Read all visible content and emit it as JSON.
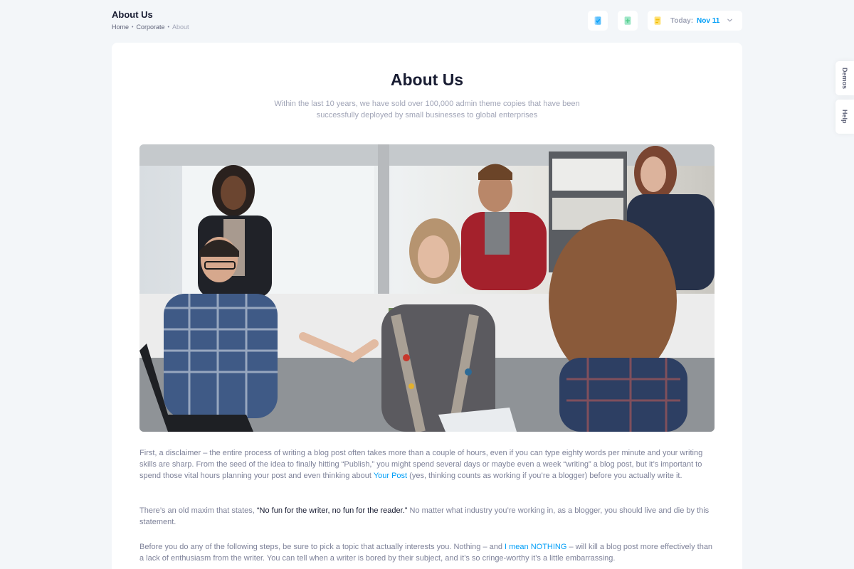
{
  "header": {
    "title": "About Us",
    "breadcrumb": [
      "Home",
      "Corporate",
      "About"
    ],
    "date_label": "Today:",
    "date_value": "Nov 11"
  },
  "side_tabs": [
    "Demos",
    "Help"
  ],
  "main": {
    "title": "About Us",
    "subtitle": "Within the last 10 years, we have sold over 100,000 admin theme copies that have been successfully deployed by small businesses to global enterprises",
    "paragraphs": [
      {
        "before": "First, a disclaimer – the entire process of writing a blog post often takes more than a couple of hours, even if you can type eighty words per minute and your writing skills are sharp. From the seed of the idea to finally hitting “Publish,” you might spend several days or maybe even a week “writing” a blog post, but it’s important to spend those vital hours planning your post and even thinking about ",
        "link": "Your Post",
        "after": " (yes, thinking counts as working if you’re a blogger) before you actually write it."
      },
      {
        "before": "There’s an old maxim that states, ",
        "highlight": "“No fun for the writer, no fun for the reader.”",
        "after": " No matter what industry you’re working in, as a blogger, you should live and die by this statement."
      },
      {
        "before": "Before you do any of the following steps, be sure to pick a topic that actually interests you. Nothing – and ",
        "link": "I mean NOTHING",
        "after": " – will kill a blog post more effectively than a lack of enthusiasm from the writer. You can tell when a writer is bored by their subject, and it’s so cringe-worthy it’s a little embarrassing."
      }
    ]
  },
  "colors": {
    "background": "#f3f6f9",
    "card": "#ffffff",
    "primary": "#009ef7",
    "text_dark": "#181c32",
    "text_muted": "#7e8299"
  },
  "icons": [
    "file-check-icon",
    "file-add-icon",
    "notes-icon",
    "chevron-down-icon"
  ]
}
